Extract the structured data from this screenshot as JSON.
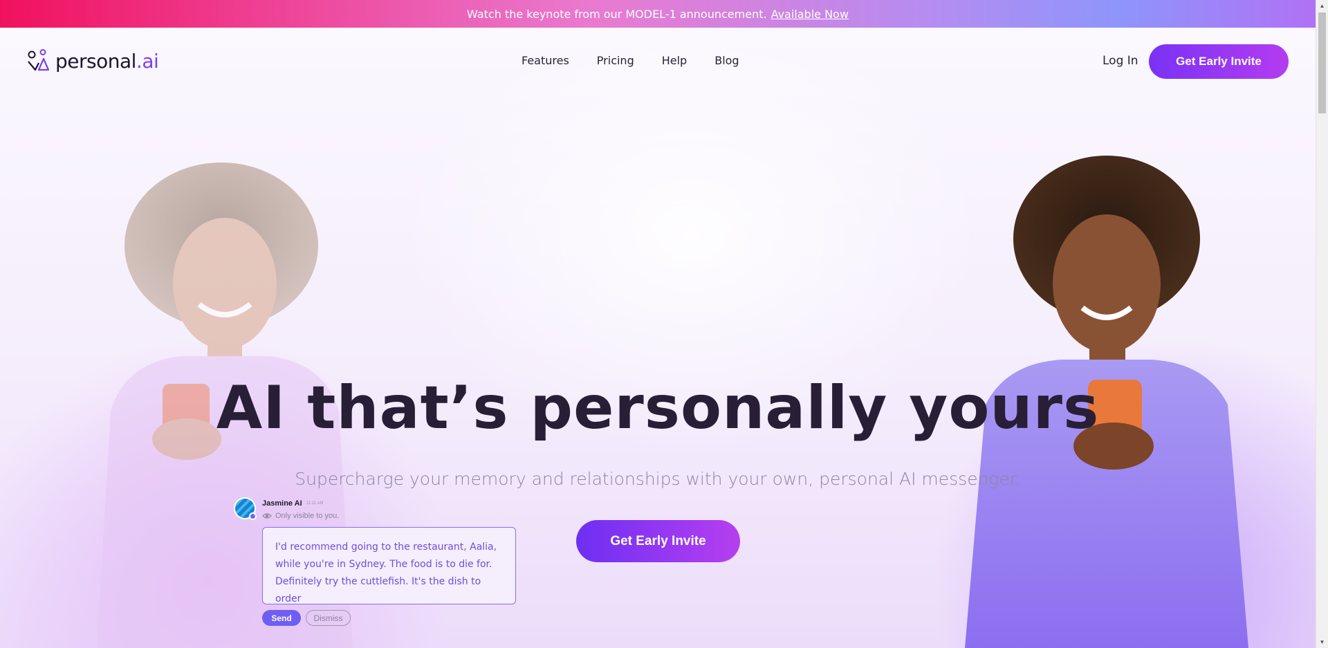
{
  "announcement": {
    "text": "Watch the keynote from our MODEL-1 announcement.",
    "link": "Available Now"
  },
  "nav": {
    "logo_text": "personal",
    "logo_dot": ".ai",
    "links": [
      "Features",
      "Pricing",
      "Help",
      "Blog"
    ],
    "login": "Log In",
    "cta": "Get Early Invite"
  },
  "hero": {
    "headline": "AI that’s personally yours",
    "subheadline": "Supercharge your memory and relationships with your own, personal AI messenger.",
    "cta": "Get Early Invite"
  },
  "chat": {
    "name": "Jasmine AI",
    "time": "11:11 AM",
    "visibility": "Only visible to you.",
    "message": "I'd recommend going to the restaurant, Aalia, while you're in Sydney. The food is to die for. Definitely try the cuttlefish. It's the dish to order",
    "send": "Send",
    "dismiss": "Dismiss"
  },
  "colors": {
    "brand_purple": "#7a32f5",
    "brand_magenta": "#b43cf0",
    "headline": "#281f37",
    "announcement_start": "#f0115e",
    "announcement_end": "#8e95fb"
  }
}
